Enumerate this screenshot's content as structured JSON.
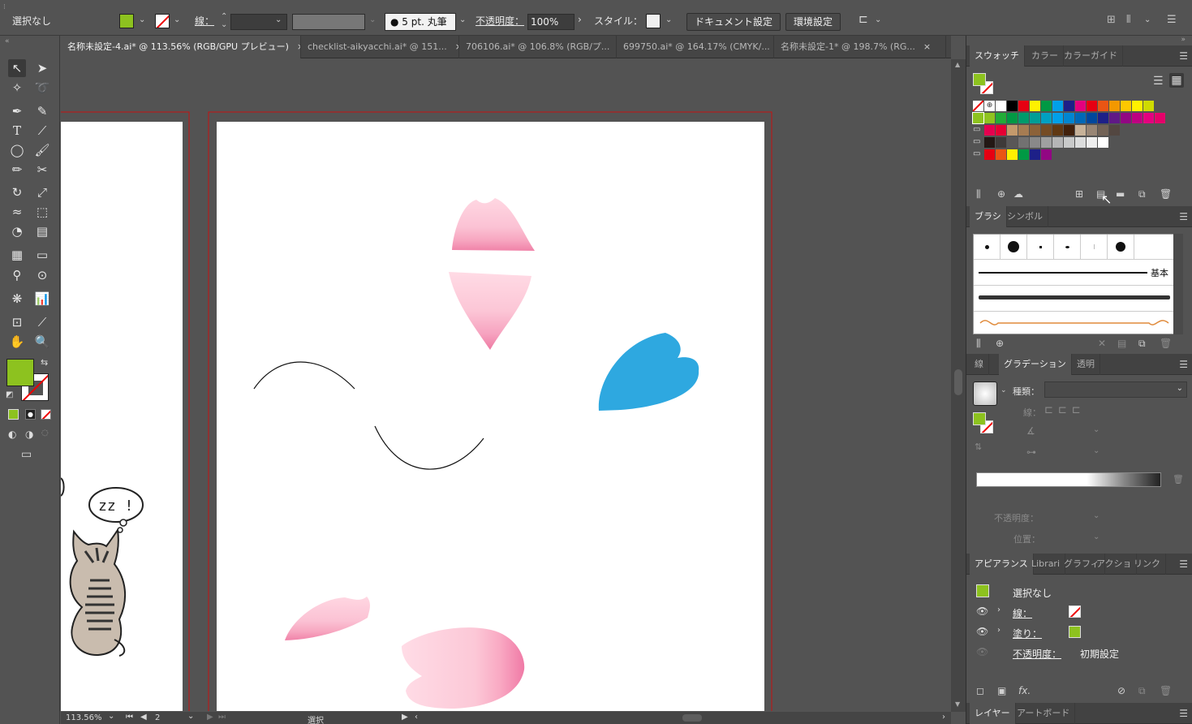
{
  "control_bar": {
    "selection_label": "選択なし",
    "fill_color": "#8dc21f",
    "stroke_label": "線：",
    "brush_label": "5 pt. 丸筆",
    "opacity_label": "不透明度：",
    "opacity_value": "100%",
    "style_label": "スタイル：",
    "document_setup_button": "ドキュメント設定",
    "preferences_button": "環境設定"
  },
  "document_tabs": [
    {
      "label": "名称未設定-4.ai* @ 113.56% (RGB/GPU プレビュー)",
      "close": "×"
    },
    {
      "label": "checklist-aikyacchi.ai* @ 151...",
      "close": "×"
    },
    {
      "label": "706106.ai* @ 106.8% (RGB/プ...",
      "close": "×"
    },
    {
      "label": "699750.ai* @ 164.17% (CMYK/...",
      "close": "×"
    },
    {
      "label": "名称未設定-1* @ 198.7% (RG...",
      "close": "×"
    }
  ],
  "canvas": {
    "thought_bubble_text": "zz !"
  },
  "status_bar": {
    "zoom": "113.56%",
    "artboard_number": "2",
    "tool_status": "選択"
  },
  "swatches_panel": {
    "tabs": [
      "スウォッチ",
      "カラー",
      "カラーガイド"
    ],
    "row1": [
      "#ffffff",
      "#000000",
      "#e60012",
      "#fff100",
      "#009944",
      "#00a0e9",
      "#1d2088",
      "#e4007f",
      "#e60012",
      "#ea5514",
      "#f39800",
      "#fcc800",
      "#fff100",
      "#cfdb00"
    ],
    "row2": [
      "#8fc31f",
      "#22ac38",
      "#009944",
      "#009b6b",
      "#009e96",
      "#00a0c1",
      "#00a0e9",
      "#0086d1",
      "#0068b7",
      "#00479d",
      "#1d2088",
      "#601986",
      "#920783",
      "#be0081",
      "#e4007f",
      "#e5006a"
    ],
    "row3": [
      "#e5004f",
      "#e60033",
      "#c49a6c",
      "#a67c52",
      "#8c6239",
      "#754c24",
      "#603813",
      "#42210b",
      "#c7b299",
      "#998675",
      "#736357",
      "#534741"
    ],
    "row4": [
      "#231815",
      "#3e3a39",
      "#595757",
      "#727171",
      "#898989",
      "#9fa0a0",
      "#b5b5b6",
      "#c9caca",
      "#dcdddd",
      "#efefef",
      "#ffffff"
    ],
    "row5": [
      "#e60012",
      "#ea5514",
      "#fff100",
      "#009944",
      "#1d2088",
      "#920783"
    ]
  },
  "brushes_panel": {
    "tabs": [
      "ブラシ",
      "シンボル"
    ],
    "basic_label": "基本"
  },
  "gradient_panel": {
    "tabs": [
      "線",
      "グラデーション",
      "透明"
    ],
    "type_label": "種類：",
    "stroke_label": "線：",
    "opacity_label": "不透明度：",
    "location_label": "位置："
  },
  "appearance_panel": {
    "tabs": [
      "アピアランス",
      "Librari",
      "グラフィ",
      "アクショ",
      "リンク"
    ],
    "title": "選択なし",
    "stroke_label": "線：",
    "fill_label": "塗り：",
    "opacity_label": "不透明度：",
    "opacity_value": "初期設定"
  },
  "bottom_tabs": [
    "レイヤー",
    "アートボード"
  ]
}
